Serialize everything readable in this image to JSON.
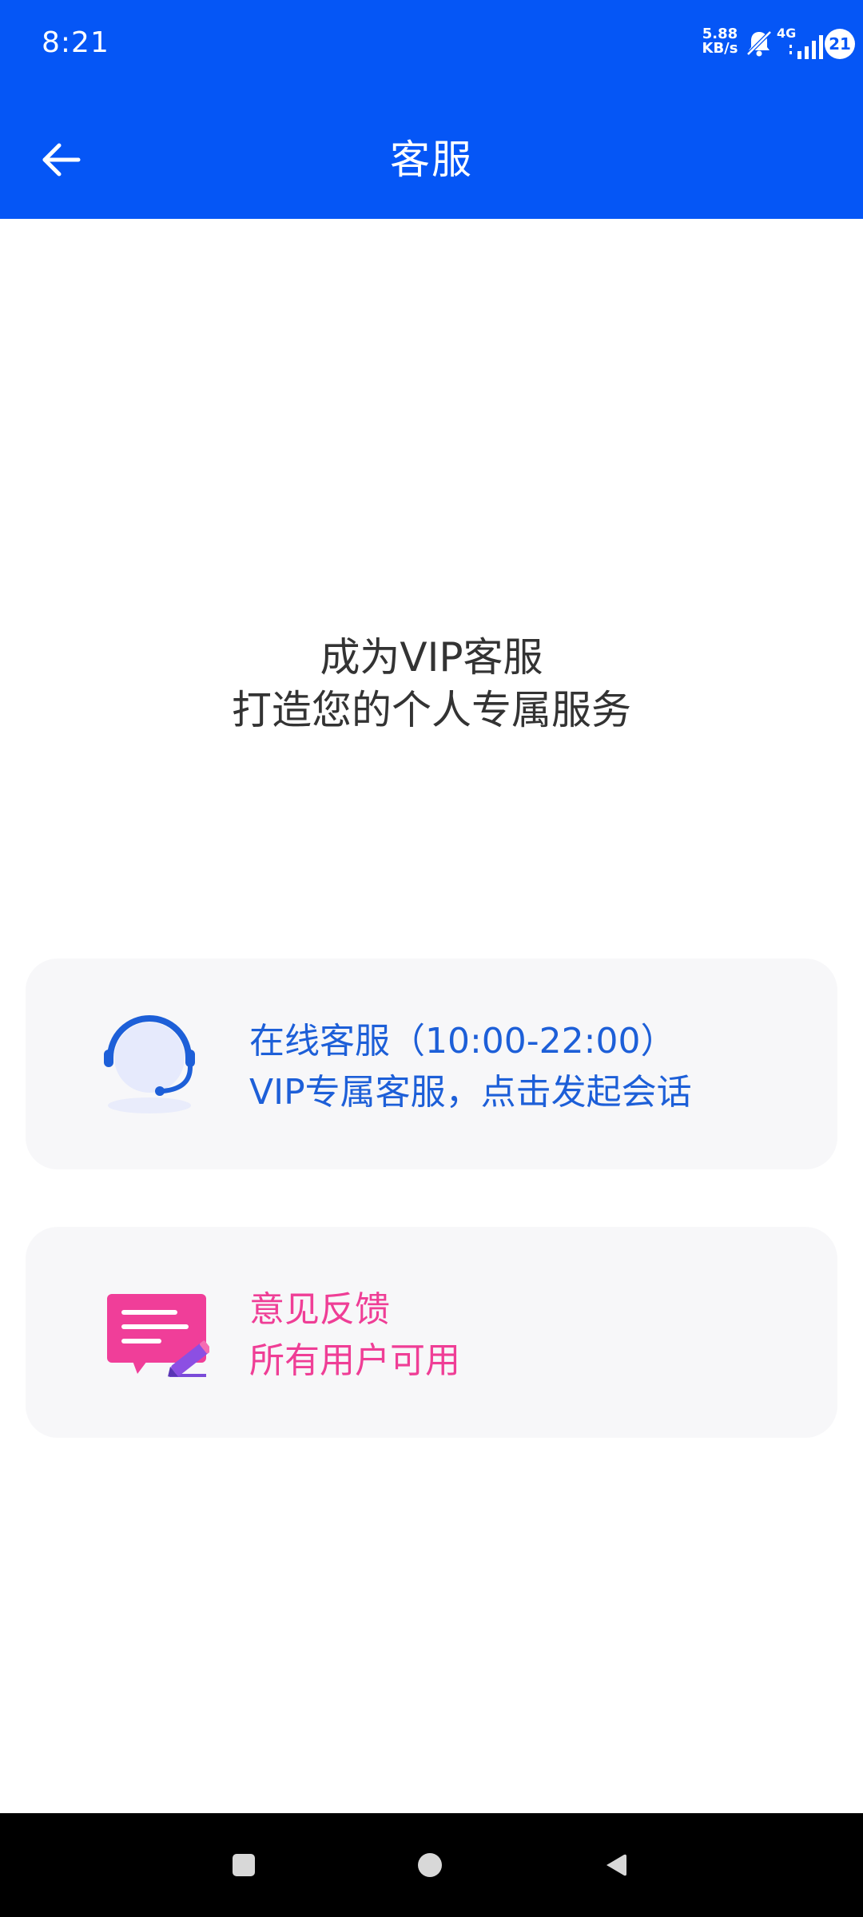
{
  "status_bar": {
    "time": "8:21",
    "net_speed_value": "5.88",
    "net_speed_unit": "KB/s",
    "network_type": "4G",
    "battery_level": "21",
    "icons": [
      "bell-off-icon",
      "signal-icon"
    ]
  },
  "app_bar": {
    "title": "客服",
    "back_icon": "arrow-left-icon"
  },
  "promo": {
    "line1": "成为VIP客服",
    "line2": "打造您的个人专属服务"
  },
  "cards": [
    {
      "id": "online-service",
      "title": "在线客服（10:00-22:00）",
      "subtitle": "VIP专属客服，点击发起会话",
      "icon": "headset-agent-icon",
      "text_color": "#1d5fd8"
    },
    {
      "id": "feedback",
      "title": "意见反馈",
      "subtitle": "所有用户可用",
      "icon": "feedback-message-icon",
      "text_color": "#ef3e96"
    }
  ],
  "nav_bar": {
    "buttons": [
      "recents-icon",
      "home-icon",
      "back-triangle-icon"
    ]
  },
  "colors": {
    "primary": "#0556f6",
    "card_background": "#f7f7f9",
    "service_accent": "#1d5fd8",
    "feedback_accent": "#ef3e96",
    "promo_text": "#333333"
  }
}
